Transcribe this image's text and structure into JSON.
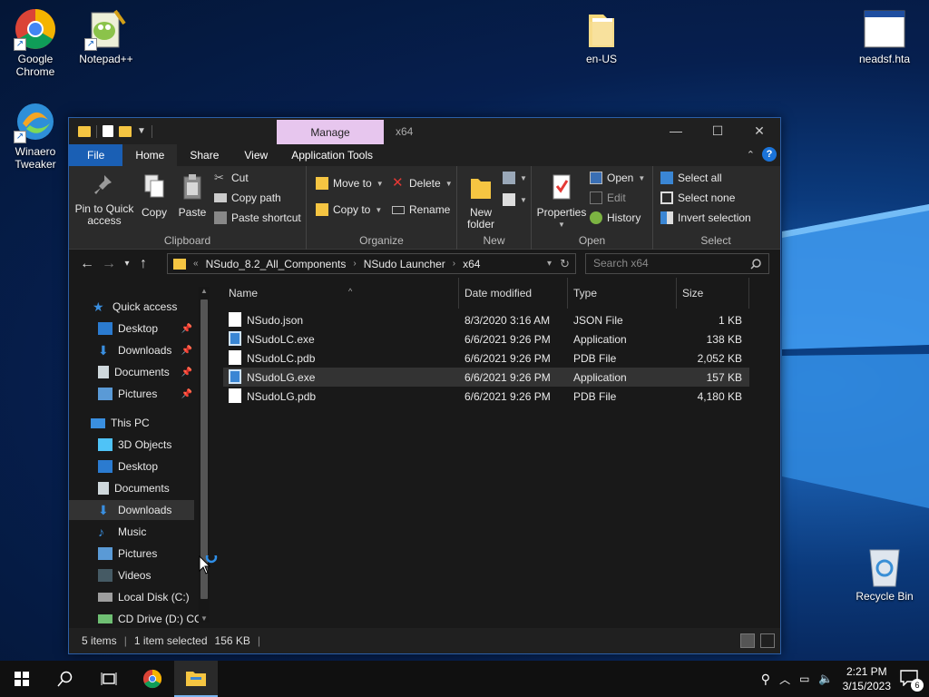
{
  "desktop": {
    "icons": [
      {
        "label": "Google\nChrome",
        "line1": "Google",
        "line2": "Chrome",
        "icon": "chrome-icon"
      },
      {
        "label": "Notepad++",
        "line1": "Notepad++",
        "icon": "notepadpp-icon"
      },
      {
        "label": "Winaero\nTweaker",
        "line1": "Winaero",
        "line2": "Tweaker",
        "icon": "winaero-icon"
      },
      {
        "label": "en-US",
        "line1": "en-US",
        "icon": "folder-icon"
      },
      {
        "label": "neadsf.hta",
        "line1": "neadsf.hta",
        "icon": "hta-window-icon"
      },
      {
        "label": "Recycle Bin",
        "line1": "Recycle Bin",
        "icon": "recycle-bin-icon"
      }
    ]
  },
  "window": {
    "contextual_tab": "Manage",
    "title": "x64",
    "controls": {
      "minimize": "—",
      "maximize": "☐",
      "close": "✕"
    }
  },
  "ribbon_tabs": {
    "file": "File",
    "home": "Home",
    "share": "Share",
    "view": "View",
    "app_tools": "Application Tools"
  },
  "ribbon": {
    "clipboard": {
      "label": "Clipboard",
      "pin_line1": "Pin to Quick",
      "pin_line2": "access",
      "copy": "Copy",
      "paste": "Paste",
      "cut": "Cut",
      "copy_path": "Copy path",
      "paste_shortcut": "Paste shortcut"
    },
    "organize": {
      "label": "Organize",
      "move_to": "Move to",
      "copy_to": "Copy to",
      "delete": "Delete",
      "rename": "Rename"
    },
    "new": {
      "label": "New",
      "new_folder_line1": "New",
      "new_folder_line2": "folder"
    },
    "open": {
      "label": "Open",
      "properties": "Properties",
      "open": "Open",
      "edit": "Edit",
      "history": "History"
    },
    "select": {
      "label": "Select",
      "select_all": "Select all",
      "select_none": "Select none",
      "invert": "Invert selection"
    }
  },
  "address": {
    "crumbs": [
      "NSudo_8.2_All_Components",
      "NSudo Launcher",
      "x64"
    ],
    "search_placeholder": "Search x64"
  },
  "nav": {
    "quick_access": "Quick access",
    "quick_items": [
      "Desktop",
      "Downloads",
      "Documents",
      "Pictures"
    ],
    "this_pc": "This PC",
    "pc_items": [
      "3D Objects",
      "Desktop",
      "Documents",
      "Downloads",
      "Music",
      "Pictures",
      "Videos",
      "Local Disk (C:)",
      "CD Drive (D:) CC"
    ],
    "selected": "Downloads"
  },
  "columns": {
    "name": "Name",
    "date": "Date modified",
    "type": "Type",
    "size": "Size"
  },
  "files": [
    {
      "name": "NSudo.json",
      "date": "8/3/2020 3:16 AM",
      "type": "JSON File",
      "size": "1 KB",
      "kind": "doc"
    },
    {
      "name": "NSudoLC.exe",
      "date": "6/6/2021 9:26 PM",
      "type": "Application",
      "size": "138 KB",
      "kind": "exe"
    },
    {
      "name": "NSudoLC.pdb",
      "date": "6/6/2021 9:26 PM",
      "type": "PDB File",
      "size": "2,052 KB",
      "kind": "doc"
    },
    {
      "name": "NSudoLG.exe",
      "date": "6/6/2021 9:26 PM",
      "type": "Application",
      "size": "157 KB",
      "kind": "exe"
    },
    {
      "name": "NSudoLG.pdb",
      "date": "6/6/2021 9:26 PM",
      "type": "PDB File",
      "size": "4,180 KB",
      "kind": "doc"
    }
  ],
  "status": {
    "items": "5 items",
    "selected": "1 item selected",
    "size": "156 KB"
  },
  "taskbar": {
    "time": "2:21 PM",
    "date": "3/15/2023",
    "notifications": "6"
  },
  "colors": {
    "accent": "#1a5fb4",
    "manage_tab": "#e7c6ee",
    "folder": "#f5c542"
  }
}
